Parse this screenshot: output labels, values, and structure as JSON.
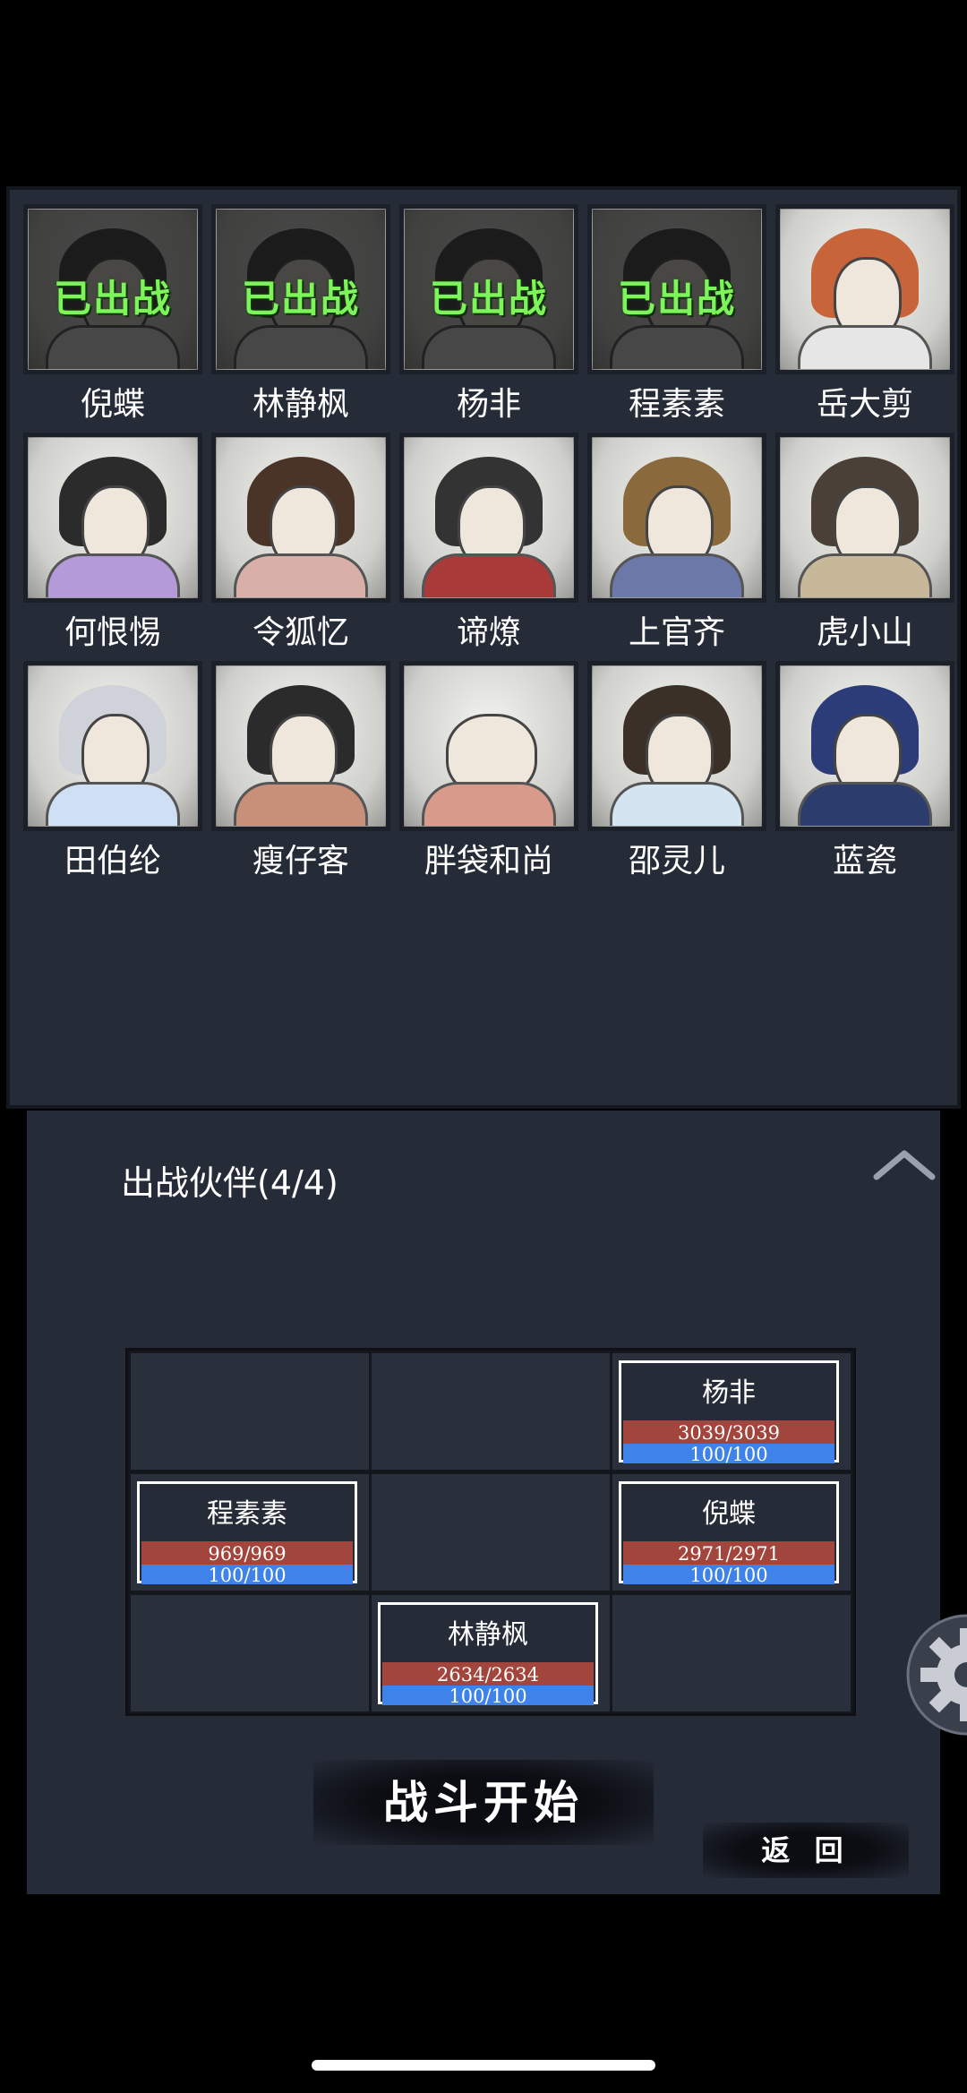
{
  "roster": [
    {
      "name": "倪蝶",
      "status": "已出战",
      "deployed": true
    },
    {
      "name": "林静枫",
      "status": "已出战",
      "deployed": true
    },
    {
      "name": "杨非",
      "status": "已出战",
      "deployed": true
    },
    {
      "name": "程素素",
      "status": "已出战",
      "deployed": true
    },
    {
      "name": "岳大剪",
      "status": "",
      "deployed": false
    },
    {
      "name": "何恨惕",
      "status": "",
      "deployed": false
    },
    {
      "name": "令狐忆",
      "status": "",
      "deployed": false
    },
    {
      "name": "谛燎",
      "status": "",
      "deployed": false
    },
    {
      "name": "上官齐",
      "status": "",
      "deployed": false
    },
    {
      "name": "虎小山",
      "status": "",
      "deployed": false
    },
    {
      "name": "田伯纶",
      "status": "",
      "deployed": false
    },
    {
      "name": "瘦仔客",
      "status": "",
      "deployed": false
    },
    {
      "name": "胖袋和尚",
      "status": "",
      "deployed": false
    },
    {
      "name": "邵灵儿",
      "status": "",
      "deployed": false
    },
    {
      "name": "蓝瓷",
      "status": "",
      "deployed": false
    }
  ],
  "party": {
    "title": "出战伙伴(4/4)",
    "formation": [
      {
        "name": "杨非",
        "hp": "3039/3039",
        "mp": "100/100"
      },
      {
        "name": "程素素",
        "hp": "969/969",
        "mp": "100/100"
      },
      {
        "name": "倪蝶",
        "hp": "2971/2971",
        "mp": "100/100"
      },
      {
        "name": "林静枫",
        "hp": "2634/2634",
        "mp": "100/100"
      }
    ],
    "start_label": "战斗开始",
    "back_label": "返 回"
  },
  "icons": {
    "collapse": "chevron-up-icon",
    "settings": "gear-icon"
  },
  "colors": {
    "deployed_label": "#7df55a",
    "hp_bar": "#a2453c",
    "mp_bar": "#3f83ea",
    "panel": "#262b38"
  }
}
